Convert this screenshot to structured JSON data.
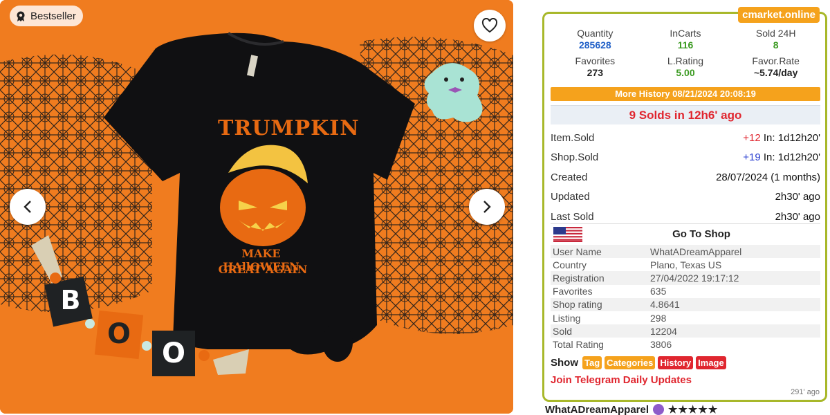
{
  "image": {
    "badge_label": "Bestseller",
    "shirt_title": "TRUMPKIN",
    "shirt_line1": "MAKE HAllOWEEN",
    "shirt_line2": "GREAT AGAIN",
    "boo_letter1": "B",
    "boo_letter2": "O",
    "boo_letter3": "O"
  },
  "panel": {
    "brand": "cmarket.online",
    "stats": [
      {
        "label": "Quantity",
        "value": "285628",
        "color": "#1f5fc7"
      },
      {
        "label": "InCarts",
        "value": "116",
        "color": "#3a9a20"
      },
      {
        "label": "Sold 24H",
        "value": "8",
        "color": "#3a9a20"
      },
      {
        "label": "Favorites",
        "value": "273",
        "color": "#222222"
      },
      {
        "label": "L.Rating",
        "value": "5.00",
        "color": "#3a9a20"
      },
      {
        "label": "Favor.Rate",
        "value": "~5.74/day",
        "color": "#222222"
      }
    ],
    "stat_labels_colors": {
      "l_rating": "#1f5fc7"
    },
    "history_label": "More History 08/21/2024 20:08:19",
    "sold_summary": "9 Solds in 12h6' ago",
    "rows": {
      "item_sold_label": "Item.Sold",
      "item_sold_delta": "+12",
      "item_sold_in": " In: 1d12h20'",
      "shop_sold_label": "Shop.Sold",
      "shop_sold_delta": "+19",
      "shop_sold_in": " In: 1d12h20'",
      "created_label": "Created",
      "created_value": "28/07/2024 (1 months)",
      "updated_label": "Updated",
      "updated_value": "2h30' ago",
      "last_sold_label": "Last Sold",
      "last_sold_value": "2h30' ago"
    },
    "go_to_shop": "Go To Shop",
    "shop_info": [
      {
        "key": "User Name",
        "value": "WhatADreamApparel"
      },
      {
        "key": "Country",
        "value": "Plano, Texas US"
      },
      {
        "key": "Registration",
        "value": "27/04/2022 19:17:12"
      },
      {
        "key": "Favorites",
        "value": "635"
      },
      {
        "key": "Shop rating",
        "value": "4.8641"
      },
      {
        "key": "Listing",
        "value": "298"
      },
      {
        "key": "Sold",
        "value": "12204"
      },
      {
        "key": "Total Rating",
        "value": "3806"
      }
    ],
    "show_label": "Show",
    "show_buttons": [
      "Tag",
      "Categories",
      "History",
      "Image"
    ],
    "telegram_link": "Join Telegram Daily Updates",
    "age": "291' ago"
  },
  "seller": {
    "name": "WhatADreamApparel",
    "stars": "★★★★★"
  },
  "colors": {
    "panel_border": "#a8b82a",
    "accent_orange": "#f5a21c",
    "accent_red": "#e0262f",
    "background_orange": "#f07c1f"
  },
  "icons": [
    "bestseller-icon",
    "heart-icon",
    "chevron-left-icon",
    "chevron-right-icon",
    "us-flag-icon",
    "star-seller-icon"
  ]
}
